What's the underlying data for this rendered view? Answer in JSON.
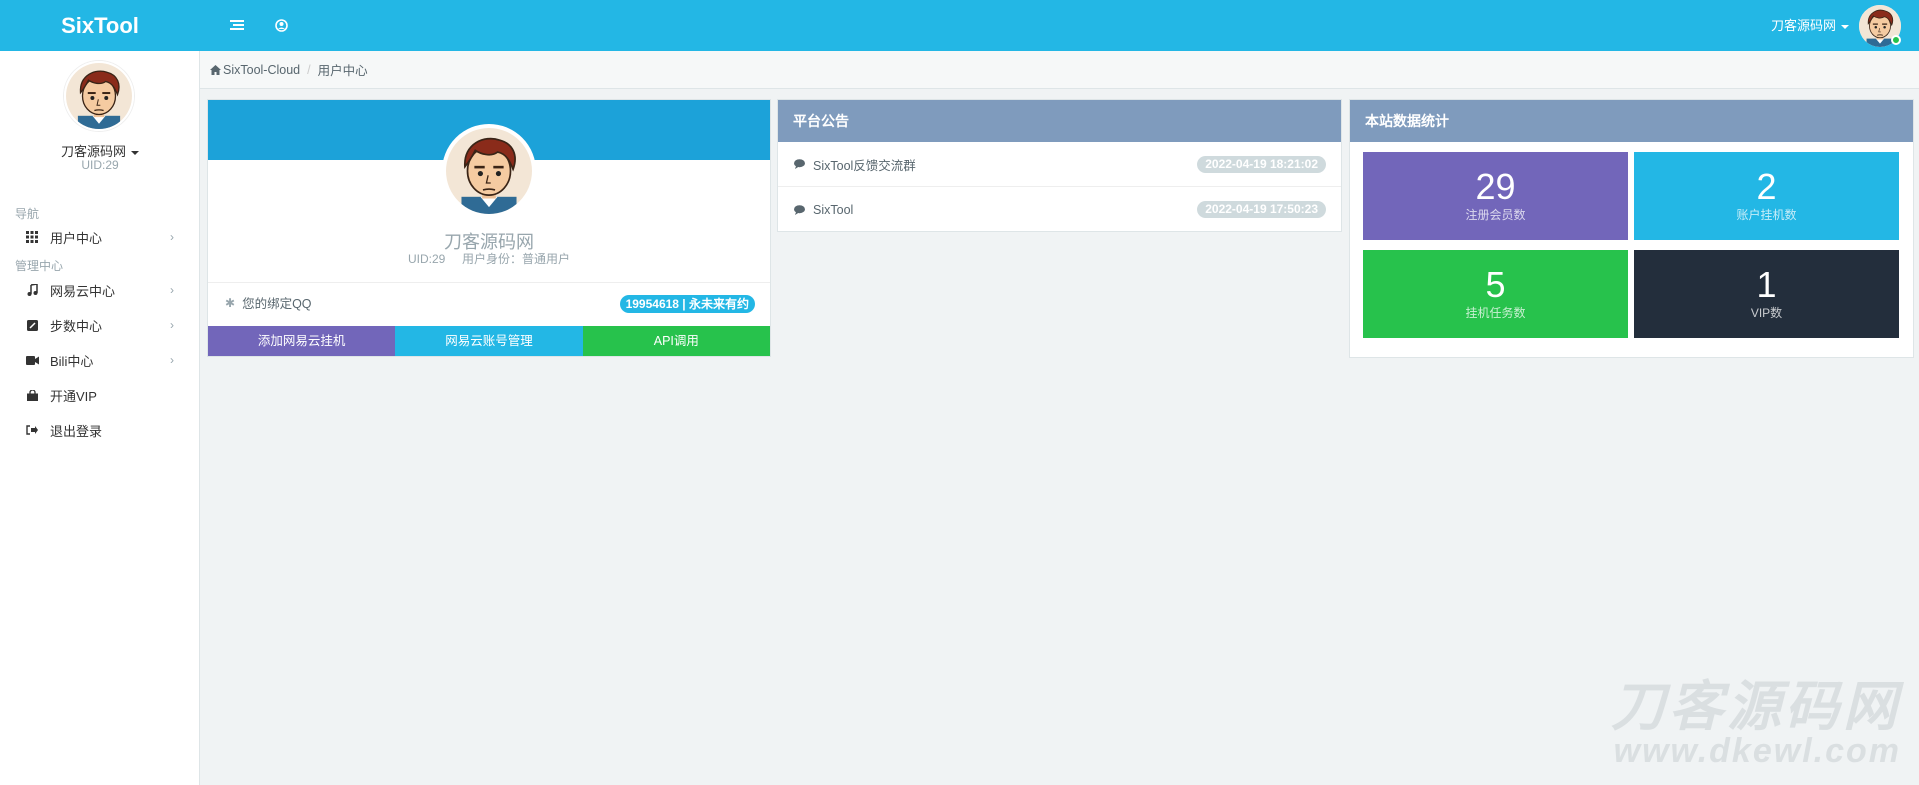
{
  "header": {
    "brand": "SixTool",
    "user_name": "刀客源码网",
    "menu_icon": "list-icon",
    "profile_icon": "user-circle-icon",
    "color": "#23b7e5"
  },
  "sidebar": {
    "user_name": "刀客源码网",
    "uid": "UID:29",
    "section_nav": "导航",
    "section_admin": "管理中心",
    "items": [
      {
        "label": "用户中心",
        "icon": "grid-icon"
      },
      {
        "label": "网易云中心",
        "icon": "music-icon"
      },
      {
        "label": "步数中心",
        "icon": "steps-icon"
      },
      {
        "label": "Bili中心",
        "icon": "video-icon"
      },
      {
        "label": "开通VIP",
        "icon": "shopping-bag-icon"
      },
      {
        "label": "退出登录",
        "icon": "logout-icon"
      }
    ]
  },
  "breadcrumb": {
    "home": "SixTool-Cloud",
    "current": "用户中心"
  },
  "profile": {
    "name": "刀客源码网",
    "uid_line": "UID:29     用户身份：普通用户",
    "qq_label": "您的绑定QQ",
    "qq_value": "19954618 | 永未来有约",
    "buttons": [
      {
        "label": "添加网易云挂机",
        "color": "#7266ba"
      },
      {
        "label": "网易云账号管理",
        "color": "#23b7e5"
      },
      {
        "label": "API调用",
        "color": "#27c24c"
      }
    ]
  },
  "notice": {
    "title": "平台公告",
    "items": [
      {
        "text": "SixTool反馈交流群",
        "time": "2022-04-19 18:21:02"
      },
      {
        "text": "SixTool",
        "time": "2022-04-19 17:50:23"
      }
    ]
  },
  "stats": {
    "title": "本站数据统计",
    "boxes": [
      {
        "value": "29",
        "label": "注册会员数",
        "color": "#7266ba"
      },
      {
        "value": "2",
        "label": "账户挂机数",
        "color": "#23b7e5"
      },
      {
        "value": "5",
        "label": "挂机任务数",
        "color": "#27c24c"
      },
      {
        "value": "1",
        "label": "VIP数",
        "color": "#232e3c"
      }
    ]
  },
  "watermark": {
    "line1": "刀客源码网",
    "line2": "www.dkewl.com"
  }
}
